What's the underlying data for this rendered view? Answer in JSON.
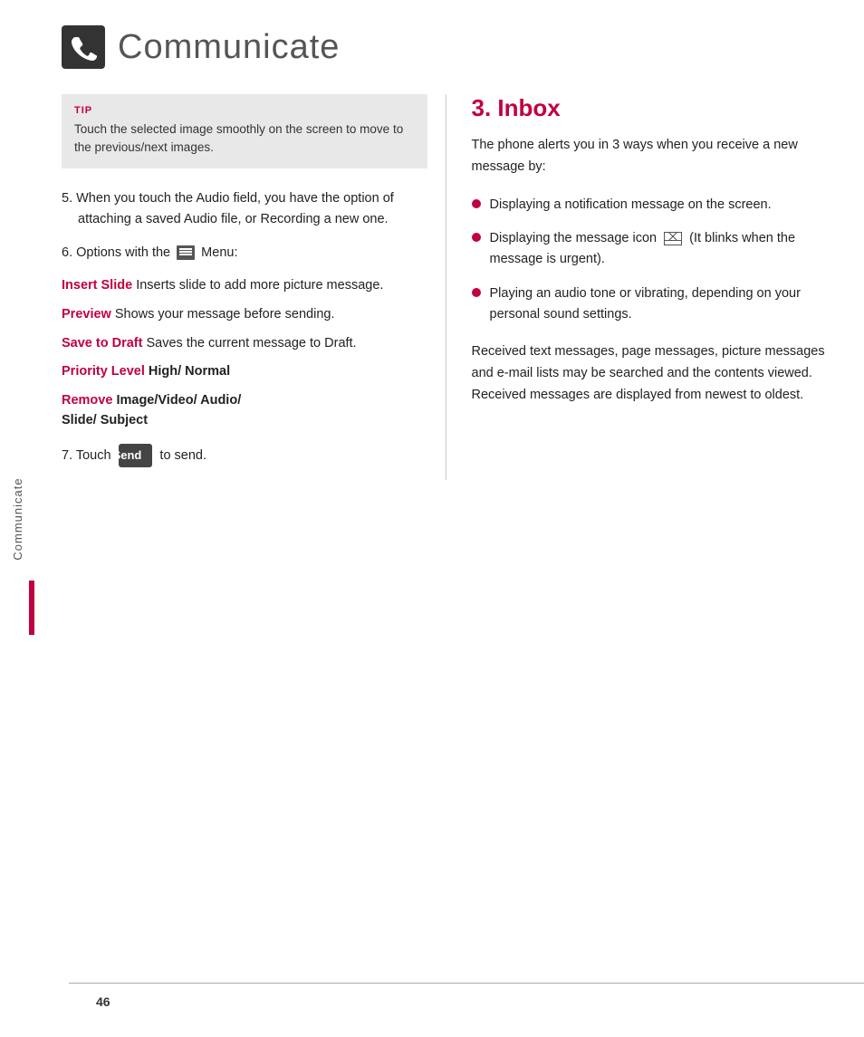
{
  "header": {
    "title": "Communicate",
    "icon_alt": "phone-icon"
  },
  "sidebar": {
    "label": "Communicate"
  },
  "left": {
    "tip": {
      "label": "TIP",
      "text": "Touch the selected image smoothly on the screen to move to the previous/next images."
    },
    "items": [
      {
        "number": "5.",
        "text": "When you touch the Audio field, you have the option of attaching a saved Audio file, or Recording a new one."
      },
      {
        "number": "6.",
        "text_before": "Options with the",
        "text_after": "Menu:"
      }
    ],
    "menu_items": [
      {
        "keyword": "Insert Slide",
        "text": " Inserts slide to add more picture message."
      },
      {
        "keyword": "Preview",
        "text": " Shows your message before sending."
      },
      {
        "keyword": "Save to Draft",
        "text": " Saves the current message to Draft."
      },
      {
        "keyword": "Priority Level",
        "text": " High/ Normal",
        "text_bold": "High/ Normal"
      },
      {
        "keyword": "Remove",
        "text": " Image/Video/ Audio/ Slide/ Subject",
        "text_bold": "Image/Video/ Audio/ Slide/ Subject"
      }
    ],
    "step7": {
      "number": "7.",
      "text_before": "Touch",
      "btn_label": "Send",
      "text_after": "to send."
    }
  },
  "right": {
    "section_title": "3. Inbox",
    "intro": "The phone alerts you in 3 ways when you receive a new message by:",
    "bullets": [
      {
        "text": "Displaying a notification message on the screen."
      },
      {
        "text": "Displaying the message icon ✉ (It blinks when the message is urgent)."
      },
      {
        "text": "Playing an audio tone or vibrating, depending on your personal sound settings."
      }
    ],
    "para": "Received text messages, page messages, picture messages and e-mail lists may be searched and the contents viewed. Received messages are displayed from newest to oldest."
  },
  "footer": {
    "page_number": "46"
  }
}
